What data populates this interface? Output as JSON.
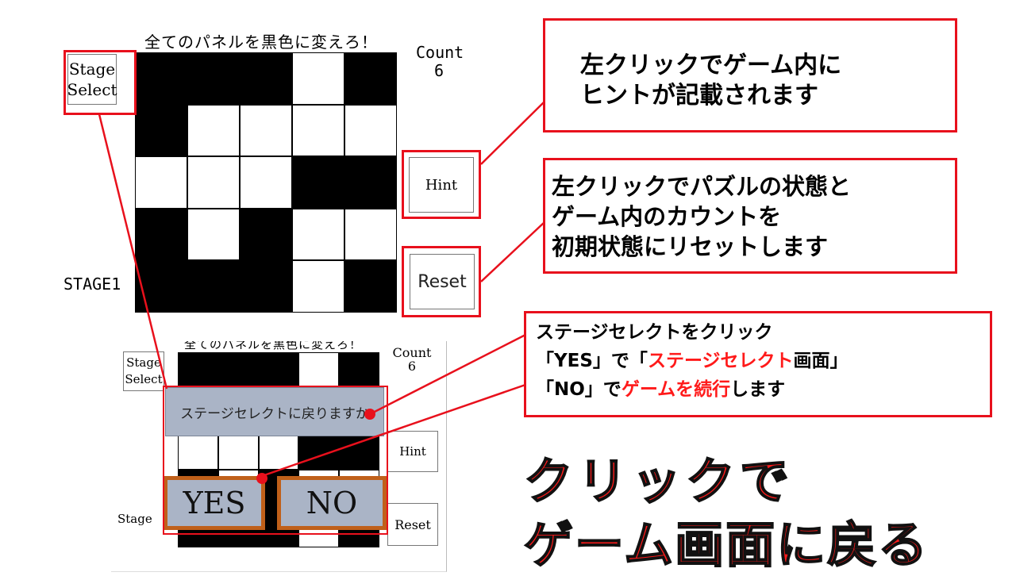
{
  "top_game": {
    "title": "全てのパネルを黒色に変えろ！",
    "count_label": "Count",
    "count_value": "6",
    "stage_select_line1": "Stage",
    "stage_select_line2": "Select",
    "hint_label": "Hint",
    "reset_label": "Reset",
    "stage_label": "STAGE1",
    "grid": [
      [
        1,
        1,
        1,
        0,
        1
      ],
      [
        1,
        0,
        0,
        0,
        0
      ],
      [
        0,
        0,
        0,
        1,
        1
      ],
      [
        1,
        0,
        1,
        0,
        0
      ],
      [
        1,
        1,
        1,
        0,
        1
      ]
    ]
  },
  "bottom_game": {
    "title": "全てのパネルを黒色に変えろ！",
    "count_label": "Count",
    "count_value": "6",
    "stage_select_line1": "Stage",
    "stage_select_line2": "Select",
    "hint_label": "Hint",
    "reset_label": "Reset",
    "stage_label": "Stage",
    "dialog_text": "ステージセレクトに戻りますか",
    "yes_label": "YES",
    "no_label": "NO"
  },
  "callouts": {
    "hint_line1": "左クリックでゲーム内に",
    "hint_line2": "ヒントが記載されます",
    "reset_line1": "左クリックでパズルの状態と",
    "reset_line2": "ゲーム内のカウントを",
    "reset_line3": "初期状態にリセットします",
    "select_line1": "ステージセレクトをクリック",
    "select_line2_a": "「YES」で「",
    "select_line2_b": "ステージセレクト",
    "select_line2_c": "画面」",
    "select_line3_a": "「NO」で",
    "select_line3_b": "ゲームを続行",
    "select_line3_c": "します",
    "big_line1": "クリックで",
    "big_line2": "ゲーム画面に戻る"
  },
  "colors": {
    "accent_red": "#e8101c",
    "highlight_red": "#ff1a1a",
    "dialog_bg": "#aab4c6",
    "button_border": "#c0601a"
  }
}
